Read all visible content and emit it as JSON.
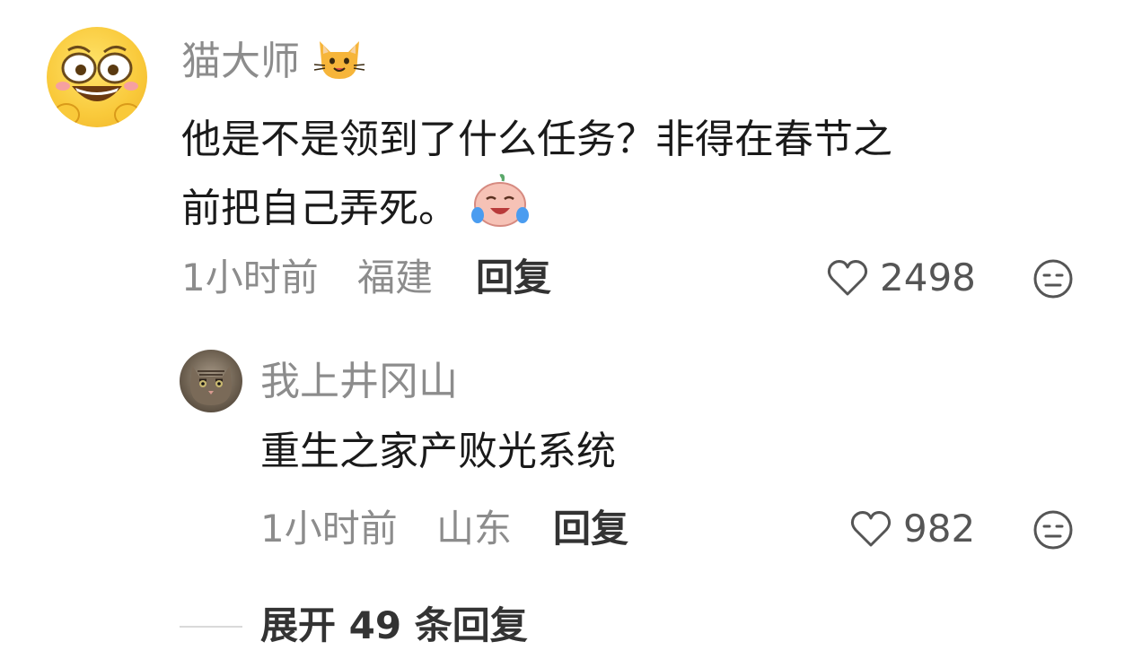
{
  "comment": {
    "username": "猫大师",
    "text_line1": "他是不是领到了什么任务？非得在春节之",
    "text_line2": "前把自己弄死。",
    "time": "1小时前",
    "location": "福建",
    "reply_label": "回复",
    "likes": "2498",
    "username_badge_icon": "cat-face-icon",
    "text_emoji_icon": "crying-laughing-sticker-icon",
    "avatar_icon": "grinning-face-avatar"
  },
  "reply": {
    "username": "我上井冈山",
    "text": "重生之家产败光系统",
    "time": "1小时前",
    "location": "山东",
    "reply_label": "回复",
    "likes": "982",
    "avatar_icon": "cat-photo-avatar"
  },
  "expand": {
    "label": "展开 49 条回复"
  },
  "colors": {
    "meta": "#8c8c8c",
    "text": "#1a1a1a",
    "accent_icon": "#555555"
  }
}
